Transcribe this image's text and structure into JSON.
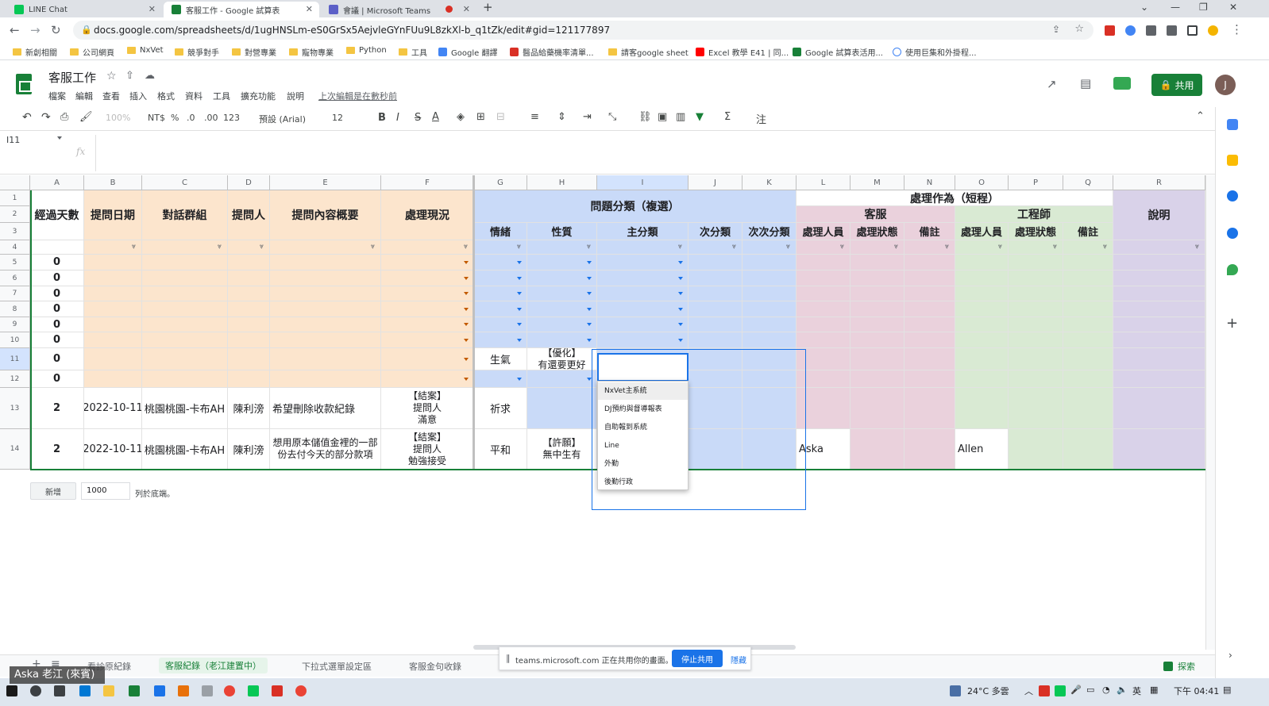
{
  "browser": {
    "tabs": [
      {
        "label": "LINE Chat",
        "color": "#06c755",
        "fav": "L"
      },
      {
        "label": "客服工作 - Google 試算表",
        "color": "#188038",
        "fav": ""
      },
      {
        "label": "會議 | Microsoft Teams",
        "color": "#5b5fc7",
        "fav": ""
      }
    ],
    "new_tab": "+",
    "url": "docs.google.com/spreadsheets/d/1ugHNSLm-eS0GrSx5AejvleGYnFUu9L8zkXl-b_q1tZk/edit#gid=121177897"
  },
  "bookmarks": [
    "新創相關",
    "公司網頁",
    "NxVet",
    "競爭對手",
    "對營專業",
    "寵物專業",
    "Python",
    "工具",
    "Google 翻譯",
    "醫品給藥機率清單...",
    "請客google sheet",
    "Excel 教學 E41 | 同...",
    "Google 試算表活用...",
    "使用巨集和外掛程..."
  ],
  "sheets": {
    "title": "客服工作",
    "menus": [
      "檔案",
      "編輯",
      "查看",
      "插入",
      "格式",
      "資料",
      "工具",
      "擴充功能",
      "說明"
    ],
    "last_edit": "上次編輯是在數秒前",
    "share_label": "共用",
    "avatar": "J"
  },
  "toolbar": {
    "zoom": "100%",
    "currency": "NT$",
    "percent": "%",
    "dec_less": ".0",
    "dec_more": ".00",
    "format": "123",
    "font": "預設 (Arial)",
    "font_size": "12"
  },
  "formula_bar": {
    "cell_ref": "I11",
    "fx": "fx"
  },
  "grid": {
    "columns": [
      "A",
      "B",
      "C",
      "D",
      "E",
      "F",
      "G",
      "H",
      "I",
      "J",
      "K",
      "L",
      "M",
      "N",
      "O",
      "P",
      "Q",
      "R"
    ],
    "rows": [
      "1",
      "2",
      "3",
      "4",
      "5",
      "6",
      "7",
      "8",
      "9",
      "10",
      "11",
      "12",
      "13",
      "14"
    ],
    "headers": {
      "A": "經過天數",
      "B": "提問日期",
      "C": "對話群組",
      "D": "提問人",
      "E": "提問內容概要",
      "F": "處理現況",
      "issue_group": "問題分類（複選）",
      "G": "情緒",
      "H": "性質",
      "I": "主分類",
      "J": "次分類",
      "K": "次次分類",
      "action_group": "處理作為（短程）",
      "cs_group": "客服",
      "eng_group": "工程師",
      "L": "處理人員",
      "M": "處理狀態",
      "N": "備註",
      "O": "處理人員",
      "P": "處理狀態",
      "Q": "備註",
      "R": "說明"
    },
    "data": {
      "days": [
        "0",
        "0",
        "0",
        "0",
        "0",
        "0",
        "0",
        "0",
        "2",
        "2"
      ],
      "row11_G": "生氣",
      "row11_H": "【優化】\n有還要更好",
      "row13": {
        "date": "2022-10-11",
        "group": "桃園桃園-卡布AH",
        "asker": "陳利滂",
        "summary": "希望刪除收款紀錄",
        "status": "【結案】\n提問人\n滿意",
        "emotion": "祈求"
      },
      "row14": {
        "date": "2022-10-11",
        "group": "桃園桃園-卡布AH",
        "asker": "陳利滂",
        "summary": "想用原本儲值金裡的一部份去付今天的部分款項",
        "status": "【結案】\n提問人\n勉強接受",
        "emotion": "平和",
        "nature": "【許願】\n無中生有",
        "cs_person": "Aska",
        "eng_person": "Allen"
      }
    }
  },
  "dropdown": {
    "options": [
      "NxVet主系統",
      "DJ預約與督導報表",
      "自助報到系統",
      "Line",
      "外勤",
      "後勤行政"
    ]
  },
  "add_rows": {
    "button": "新增",
    "count": "1000",
    "suffix": "列於底端。"
  },
  "sheet_tabs": [
    "+",
    "≡",
    "看診原紀錄",
    "客服紀錄（老江建置中）",
    "下拉式選單設定區",
    "客服金句收錄"
  ],
  "share_banner": {
    "text": "teams.microsoft.com 正在共用你的畫面。",
    "stop": "停止共用",
    "hide": "隱藏"
  },
  "explore": "探索",
  "presenter": "Aska 老江 (來賓)",
  "tray": {
    "weather": "24°C 多雲",
    "time": "下午 04:41"
  }
}
